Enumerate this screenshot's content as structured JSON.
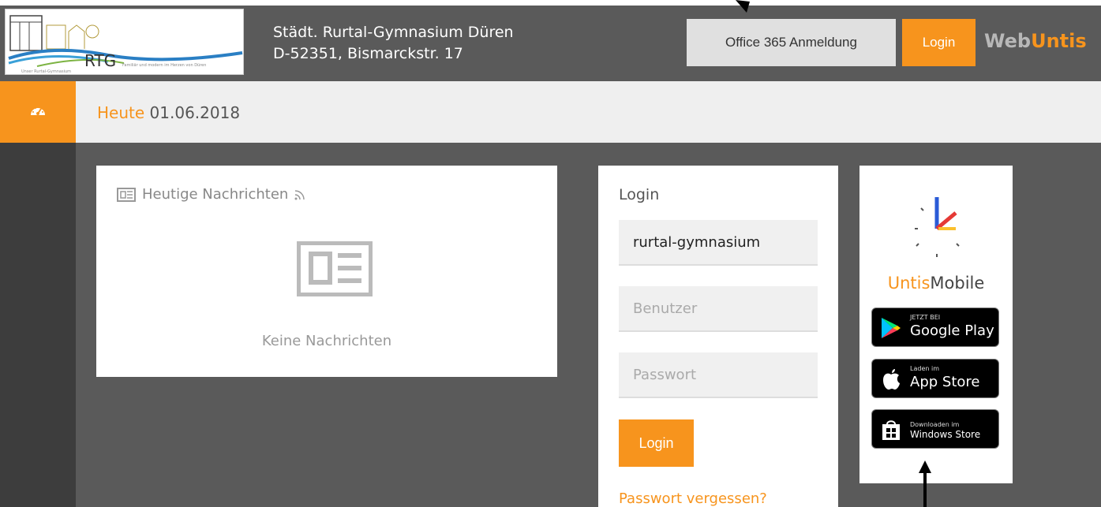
{
  "header": {
    "logo_text": "RTG",
    "logo_slogan": "Familiär und modern im Herzen von Düren",
    "logo_sub": "Unser Rurtal-Gymnasium",
    "school_name": "Städt. Rurtal-Gymnasium Düren",
    "school_address": "D-52351, Bismarckstr. 17",
    "office_button": "Office 365 Anmeldung",
    "login_button": "Login",
    "brand_prefix": "Web",
    "brand_suffix": "Untis"
  },
  "nav": {
    "items": [
      {
        "icon": "dashboard-icon",
        "active": true
      }
    ]
  },
  "subheader": {
    "label": "Heute",
    "date": "01.06.2018"
  },
  "news": {
    "title": "Heutige Nachrichten",
    "empty_text": "Keine Nachrichten"
  },
  "login": {
    "title": "Login",
    "school_value": "rurtal-gymnasium",
    "user_placeholder": "Benutzer",
    "password_placeholder": "Passwort",
    "submit_label": "Login",
    "forgot_link": "Passwort vergessen?"
  },
  "mobile": {
    "name_prefix": "Untis",
    "name_suffix": "Mobile",
    "badges": [
      {
        "small": "JETZT BEI",
        "big": "Google Play"
      },
      {
        "small": "Laden im",
        "big": "App Store"
      },
      {
        "small": "Downloaden im",
        "big": "Windows Store"
      }
    ]
  },
  "colors": {
    "accent": "#f7941d",
    "header_bg": "#5a5a5a",
    "nav_bg": "#3d3d3d",
    "subheader_bg": "#efefef"
  }
}
